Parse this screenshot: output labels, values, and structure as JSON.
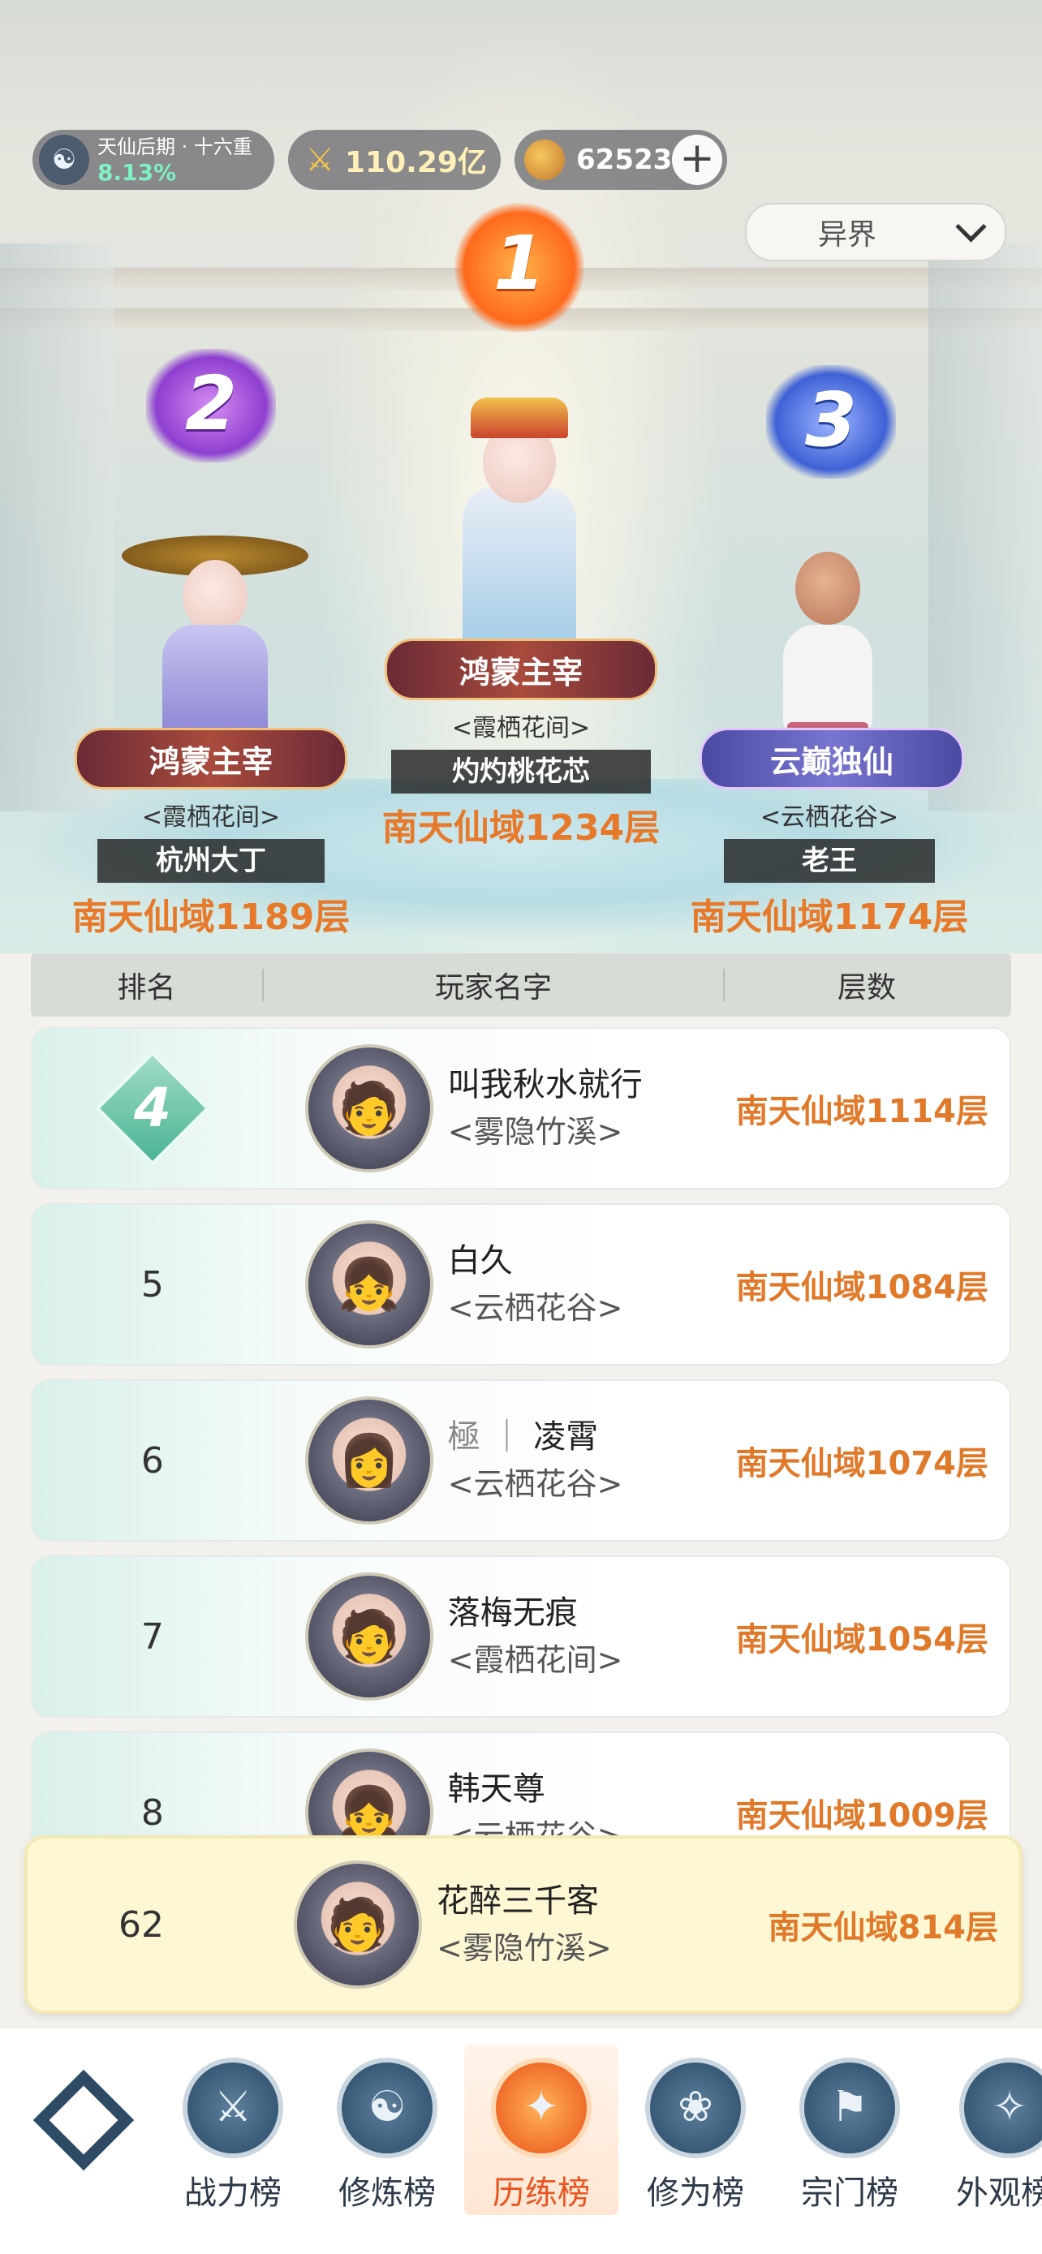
{
  "header": {
    "realm_name": "天仙后期 · 十六重",
    "realm_progress": "8.13%",
    "combat_power": "110.29亿",
    "spirit_stones": "62523",
    "plus_label": "+",
    "region_filter": "异界"
  },
  "podium": [
    {
      "rank": "1",
      "title": "鸿蒙主宰",
      "sect": "<霞栖花间>",
      "name": "灼灼桃花芯",
      "layer": "南天仙域1234层"
    },
    {
      "rank": "2",
      "title": "鸿蒙主宰",
      "sect": "<霞栖花间>",
      "name": "杭州大丁",
      "layer": "南天仙域1189层"
    },
    {
      "rank": "3",
      "title": "云巅独仙",
      "sect": "<云栖花谷>",
      "name": "老王",
      "layer": "南天仙域1174层"
    }
  ],
  "table": {
    "headers": [
      "排名",
      "玩家名字",
      "层数"
    ],
    "rows": [
      {
        "rank": "4",
        "prefix": "",
        "name": "叫我秋水就行",
        "sect": "<雾隐竹溪>",
        "layer": "南天仙域1114层"
      },
      {
        "rank": "5",
        "prefix": "",
        "name": "白久",
        "sect": "<云栖花谷>",
        "layer": "南天仙域1084层"
      },
      {
        "rank": "6",
        "prefix": "極 ｜ ",
        "name": "凌霄",
        "sect": "<云栖花谷>",
        "layer": "南天仙域1074层"
      },
      {
        "rank": "7",
        "prefix": "",
        "name": "落梅无痕",
        "sect": "<霞栖花间>",
        "layer": "南天仙域1054层"
      },
      {
        "rank": "8",
        "prefix": "",
        "name": "韩天尊",
        "sect": "<云栖花谷>",
        "layer": "南天仙域1009层"
      }
    ]
  },
  "self": {
    "rank": "62",
    "name": "花醉三千客",
    "sect": "<雾隐竹溪>",
    "layer": "南天仙域814层"
  },
  "nav": {
    "items": [
      {
        "label": "战力榜",
        "icon": "sword-icon"
      },
      {
        "label": "修炼榜",
        "icon": "yin-yang-icon"
      },
      {
        "label": "历练榜",
        "icon": "star-icon"
      },
      {
        "label": "修为榜",
        "icon": "lotus-icon"
      },
      {
        "label": "宗门榜",
        "icon": "banner-icon"
      },
      {
        "label": "外观榜",
        "icon": "robe-icon"
      }
    ],
    "active_index": 2
  },
  "colors": {
    "accent_orange": "#e07a2a",
    "active_tab": "#e9531f",
    "realm_green": "#7ff0c2"
  }
}
